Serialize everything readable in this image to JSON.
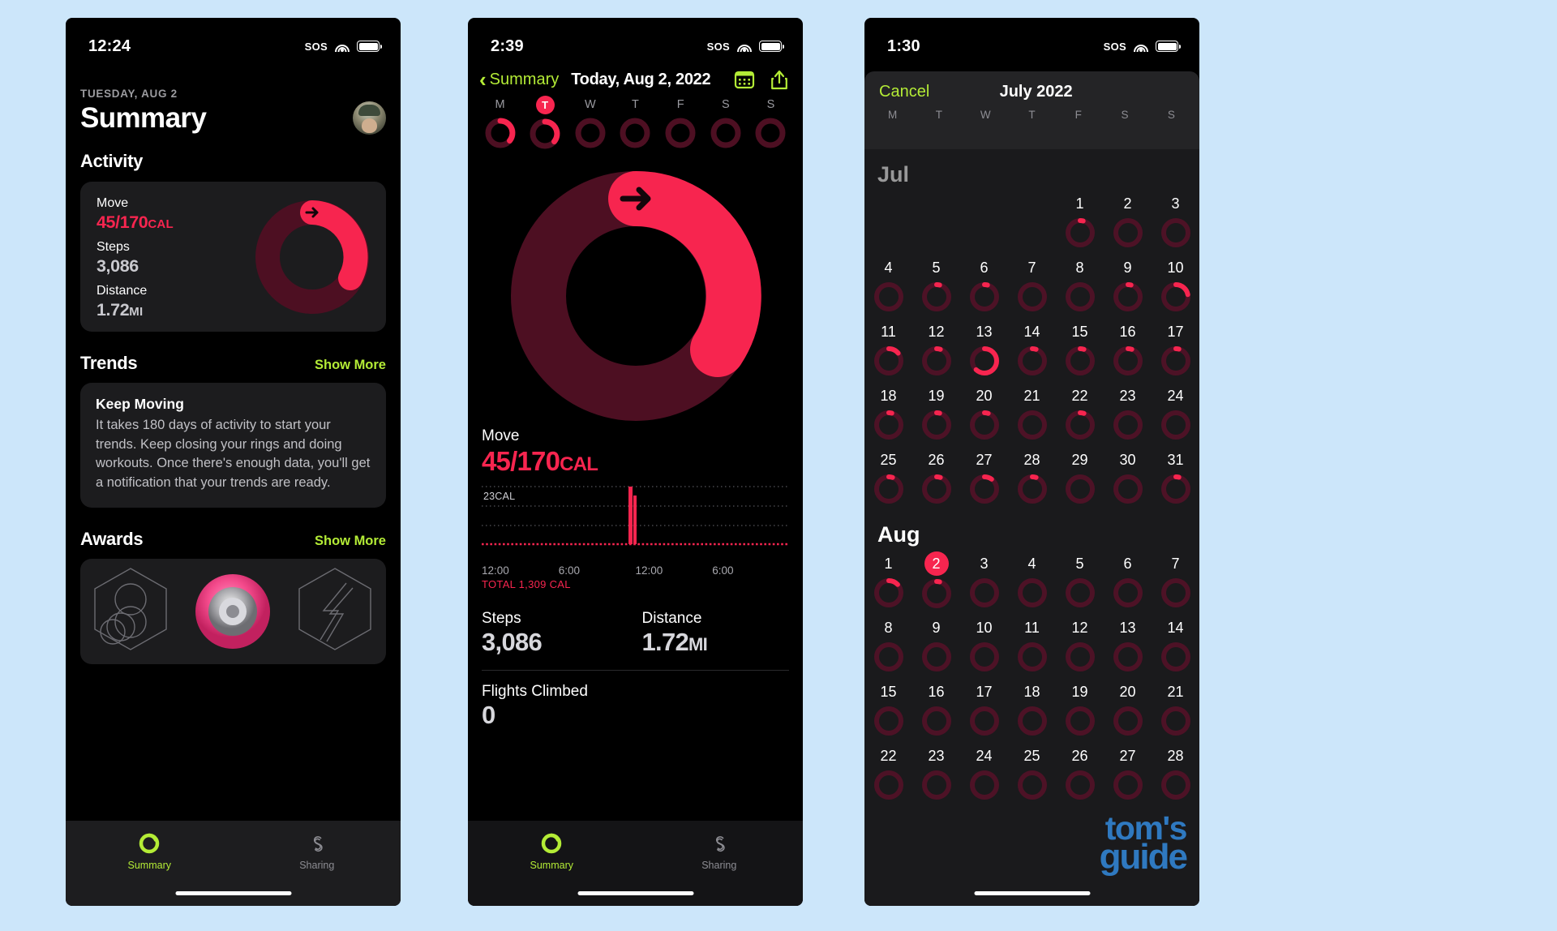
{
  "accent": {
    "green": "#b4ec36",
    "move_red": "#f7254f",
    "ring_track": "#4a0d20",
    "text_grey": "#9b9b9f"
  },
  "phone1": {
    "status": {
      "time": "12:24",
      "sos": "SOS",
      "wifi_icon": "wifi-icon",
      "battery_icon": "battery-icon"
    },
    "date_eyebrow": "TUESDAY, AUG 2",
    "title": "Summary",
    "avatar_name": "profile-avatar",
    "activity_heading": "Activity",
    "activity": {
      "move_label": "Move",
      "move_value": "45/170",
      "move_unit": "CAL",
      "steps_label": "Steps",
      "steps_value": "3,086",
      "distance_label": "Distance",
      "distance_value": "1.72",
      "distance_unit": "MI",
      "move_progress_pct": 26
    },
    "trends_heading": "Trends",
    "trends_show_more": "Show More",
    "trend_card": {
      "title": "Keep Moving",
      "body": "It takes 180 days of activity to start your trends. Keep closing your rings and doing workouts. Once there's enough data, you'll get a notification that your trends are ready."
    },
    "awards_heading": "Awards",
    "awards_show_more": "Show More",
    "awards": [
      "award-badge-rings",
      "award-badge-medal",
      "award-badge-bolt"
    ],
    "tabs": [
      {
        "label": "Summary",
        "icon": "activity-ring-icon",
        "active": true
      },
      {
        "label": "Sharing",
        "icon": "sharing-icon",
        "active": false
      }
    ]
  },
  "phone2": {
    "status": {
      "time": "2:39",
      "sos": "SOS",
      "wifi_icon": "wifi-icon",
      "battery_icon": "battery-icon"
    },
    "back_label": "Summary",
    "nav_date": "Today, Aug 2, 2022",
    "calendar_icon": "calendar-icon",
    "share_icon": "share-icon",
    "week": [
      {
        "letter": "M",
        "selected": false,
        "pct": 30
      },
      {
        "letter": "T",
        "selected": true,
        "pct": 30
      },
      {
        "letter": "W",
        "selected": false,
        "pct": 0
      },
      {
        "letter": "T",
        "selected": false,
        "pct": 0
      },
      {
        "letter": "F",
        "selected": false,
        "pct": 0
      },
      {
        "letter": "S",
        "selected": false,
        "pct": 0
      },
      {
        "letter": "S",
        "selected": false,
        "pct": 0
      }
    ],
    "move_label": "Move",
    "move_value": "45/170",
    "move_unit": "CAL",
    "big_ring_pct": 26,
    "chart": {
      "y_label": "23CAL",
      "x_ticks": [
        "12:00",
        "6:00",
        "12:00",
        "6:00"
      ],
      "total": "TOTAL 1,309 CAL"
    },
    "steps_label": "Steps",
    "steps_value": "3,086",
    "distance_label": "Distance",
    "distance_value": "1.72",
    "distance_unit": "MI",
    "flights_label": "Flights Climbed",
    "flights_value": "0",
    "tabs": [
      {
        "label": "Summary",
        "icon": "activity-ring-icon",
        "active": true
      },
      {
        "label": "Sharing",
        "icon": "sharing-icon",
        "active": false
      }
    ]
  },
  "phone3": {
    "status": {
      "time": "1:30",
      "sos": "SOS",
      "wifi_icon": "wifi-icon",
      "battery_icon": "battery-icon"
    },
    "cancel_label": "Cancel",
    "sheet_title": "July 2022",
    "day_headers": [
      "M",
      "T",
      "W",
      "T",
      "F",
      "S",
      "S"
    ],
    "months": [
      {
        "name": "Jul",
        "lead_blanks": 4,
        "days": [
          {
            "n": 1,
            "pct": 4
          },
          {
            "n": 2,
            "pct": 0
          },
          {
            "n": 3,
            "pct": 0
          },
          {
            "n": 4,
            "pct": 0
          },
          {
            "n": 5,
            "pct": 4
          },
          {
            "n": 6,
            "pct": 4
          },
          {
            "n": 7,
            "pct": 0
          },
          {
            "n": 8,
            "pct": 0
          },
          {
            "n": 9,
            "pct": 4
          },
          {
            "n": 10,
            "pct": 22
          },
          {
            "n": 11,
            "pct": 14
          },
          {
            "n": 12,
            "pct": 5
          },
          {
            "n": 13,
            "pct": 62
          },
          {
            "n": 14,
            "pct": 5
          },
          {
            "n": 15,
            "pct": 5
          },
          {
            "n": 16,
            "pct": 5
          },
          {
            "n": 17,
            "pct": 4
          },
          {
            "n": 18,
            "pct": 4
          },
          {
            "n": 19,
            "pct": 4
          },
          {
            "n": 20,
            "pct": 5
          },
          {
            "n": 21,
            "pct": 0
          },
          {
            "n": 22,
            "pct": 5
          },
          {
            "n": 23,
            "pct": 0
          },
          {
            "n": 24,
            "pct": 0
          },
          {
            "n": 25,
            "pct": 5
          },
          {
            "n": 26,
            "pct": 5
          },
          {
            "n": 27,
            "pct": 10
          },
          {
            "n": 28,
            "pct": 5
          },
          {
            "n": 29,
            "pct": 0
          },
          {
            "n": 30,
            "pct": 0
          },
          {
            "n": 31,
            "pct": 4
          }
        ]
      },
      {
        "name": "Aug",
        "lead_blanks": 0,
        "days": [
          {
            "n": 1,
            "pct": 13
          },
          {
            "n": 2,
            "pct": 4,
            "selected": true
          },
          {
            "n": 3,
            "pct": 0
          },
          {
            "n": 4,
            "pct": 0
          },
          {
            "n": 5,
            "pct": 0
          },
          {
            "n": 6,
            "pct": 0
          },
          {
            "n": 7,
            "pct": 0
          },
          {
            "n": 8,
            "pct": 0
          },
          {
            "n": 9,
            "pct": 0
          },
          {
            "n": 10,
            "pct": 0
          },
          {
            "n": 11,
            "pct": 0
          },
          {
            "n": 12,
            "pct": 0
          },
          {
            "n": 13,
            "pct": 0
          },
          {
            "n": 14,
            "pct": 0
          },
          {
            "n": 15,
            "pct": 0
          },
          {
            "n": 16,
            "pct": 0
          },
          {
            "n": 17,
            "pct": 0
          },
          {
            "n": 18,
            "pct": 0
          },
          {
            "n": 19,
            "pct": 0
          },
          {
            "n": 20,
            "pct": 0
          },
          {
            "n": 21,
            "pct": 0
          },
          {
            "n": 22,
            "pct": 0
          },
          {
            "n": 23,
            "pct": 0
          },
          {
            "n": 24,
            "pct": 0
          },
          {
            "n": 25,
            "pct": 0
          },
          {
            "n": 26,
            "pct": 0
          },
          {
            "n": 27,
            "pct": 0
          },
          {
            "n": 28,
            "pct": 0
          }
        ]
      }
    ]
  },
  "watermark": {
    "line1": "tom's",
    "line2": "guide"
  }
}
